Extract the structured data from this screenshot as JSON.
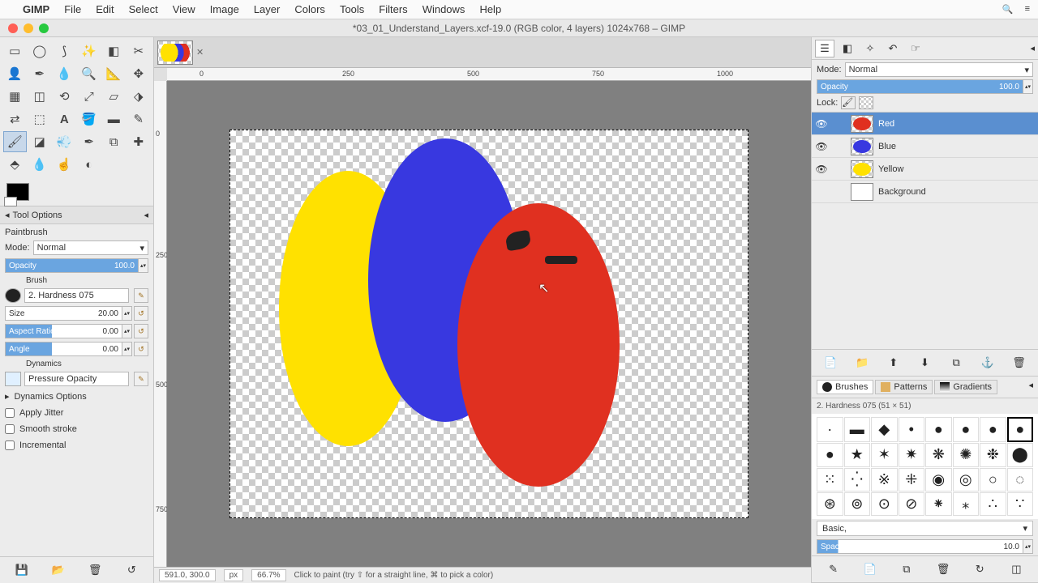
{
  "menubar": {
    "app": "GIMP",
    "items": [
      "File",
      "Edit",
      "Select",
      "View",
      "Image",
      "Layer",
      "Colors",
      "Tools",
      "Filters",
      "Windows",
      "Help"
    ]
  },
  "window": {
    "title": "*03_01_Understand_Layers.xcf-19.0 (RGB color, 4 layers) 1024x768 – GIMP"
  },
  "ruler": {
    "h": [
      "0",
      "250",
      "500",
      "750",
      "1000"
    ],
    "v": [
      "0",
      "250",
      "500",
      "750"
    ]
  },
  "tool_options": {
    "header": "Tool Options",
    "tool_name": "Paintbrush",
    "mode_label": "Mode:",
    "mode_value": "Normal",
    "opacity_label": "Opacity",
    "opacity_value": "100.0",
    "brush_label": "Brush",
    "brush_value": "2. Hardness 075",
    "size_label": "Size",
    "size_value": "20.00",
    "aspect_label": "Aspect Ratio",
    "aspect_value": "0.00",
    "angle_label": "Angle",
    "angle_value": "0.00",
    "dynamics_label": "Dynamics",
    "dynamics_value": "Pressure Opacity",
    "dyn_options": "Dynamics Options",
    "jitter": "Apply Jitter",
    "smooth": "Smooth stroke",
    "incremental": "Incremental"
  },
  "layers": {
    "mode_label": "Mode:",
    "mode_value": "Normal",
    "opacity_label": "Opacity",
    "opacity_value": "100.0",
    "lock_label": "Lock:",
    "items": [
      {
        "name": "Red",
        "visible": true,
        "selected": true,
        "thumb": "red"
      },
      {
        "name": "Blue",
        "visible": true,
        "selected": false,
        "thumb": "blue"
      },
      {
        "name": "Yellow",
        "visible": true,
        "selected": false,
        "thumb": "yellow"
      },
      {
        "name": "Background",
        "visible": false,
        "selected": false,
        "thumb": "bg"
      }
    ]
  },
  "brushes": {
    "tabs": [
      "Brushes",
      "Patterns",
      "Gradients"
    ],
    "current": "2. Hardness 075 (51 × 51)",
    "name": "Basic,",
    "spacing_label": "Spacing",
    "spacing_value": "10.0"
  },
  "status": {
    "coords": "591.0, 300.0",
    "unit": "px",
    "zoom": "66.7%",
    "hint": "Click to paint (try ⇧ for a straight line, ⌘ to pick a color)"
  }
}
